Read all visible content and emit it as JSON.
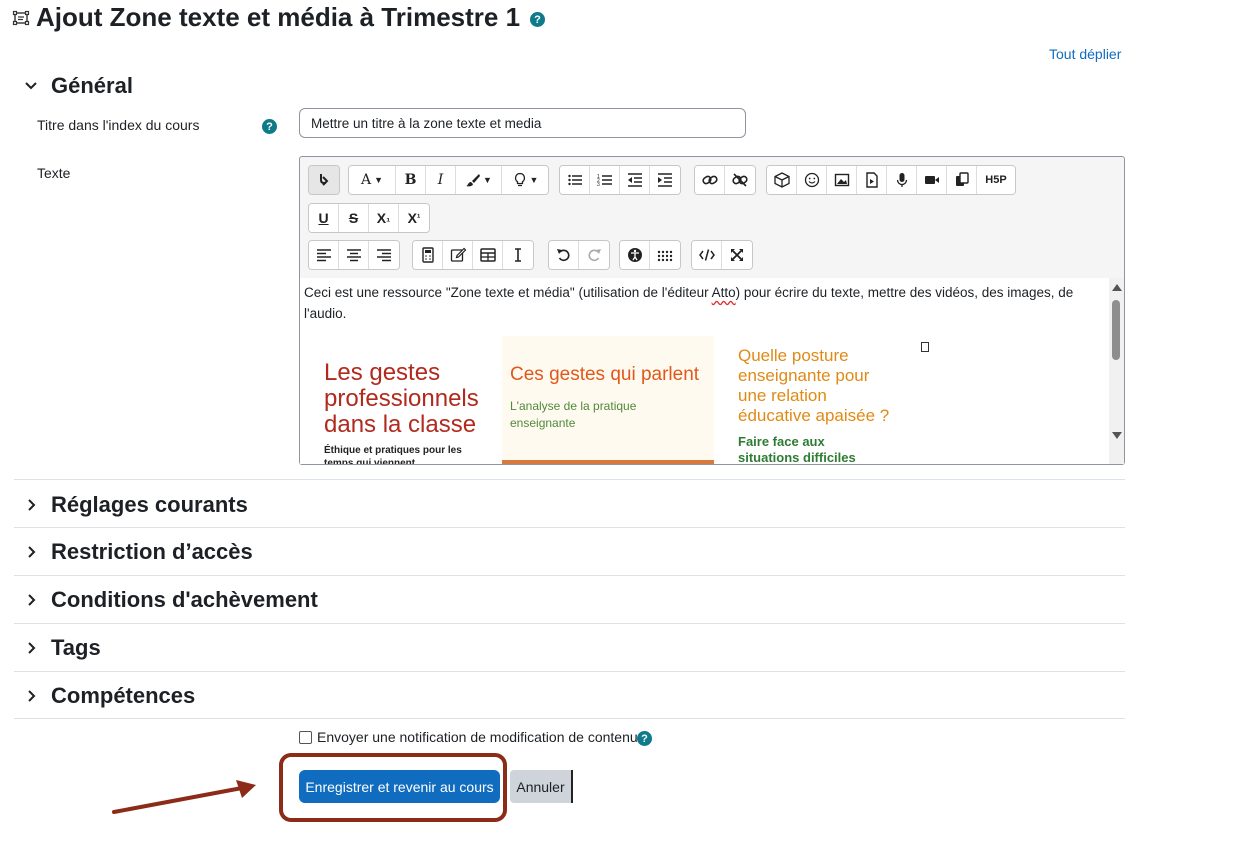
{
  "header": {
    "title": "Ajout Zone texte et média à Trimestre 1",
    "help_glyph": "?",
    "expand_all": "Tout déplier"
  },
  "general": {
    "section_title": "Général",
    "name_label": "Titre dans l'index du cours",
    "name_value": "Mettre un titre à la zone texte et media",
    "text_label": "Texte",
    "editor_content": {
      "text_before": "Ceci est une ressource \"Zone texte et média\" (utilisation de l'éditeur ",
      "text_misspelled": "Atto",
      "text_after": ") pour écrire du texte, mettre des vidéos, des images, de l'audio."
    },
    "images": [
      {
        "title": "Les gestes professionnels dans la classe",
        "subtitle": "Éthique et pratiques pour les temps qui viennent"
      },
      {
        "title": "Ces gestes qui parlent",
        "subtitle": "L'analyse de la pratique enseignante"
      },
      {
        "title": "Quelle posture enseignante pour une relation éducative apaisée ?",
        "subtitle": "Faire face aux situations difficiles"
      }
    ]
  },
  "toolbar": {
    "font_letter": "A",
    "bold": "B",
    "italic": "I",
    "underline": "U",
    "strike": "S",
    "sub_base": "X",
    "sub_idx": "₁",
    "sup_base": "X",
    "sup_idx": "¹",
    "h5p": "H5P"
  },
  "sections": [
    {
      "title": "Réglages courants"
    },
    {
      "title": "Restriction d’accès"
    },
    {
      "title": "Conditions d'achèvement"
    },
    {
      "title": "Tags"
    },
    {
      "title": "Compétences"
    }
  ],
  "footer": {
    "notify_label": "Envoyer une notification de modification de contenu",
    "save_button": "Enregistrer et revenir au cours",
    "cancel_button": "Annuler"
  },
  "colors": {
    "primary": "#0f6cbf",
    "help": "#0f7a8a",
    "annotation": "#8b2b18"
  },
  "icons": [
    "activity-icon",
    "chevron-down-icon",
    "chevron-right-icon",
    "help-icon",
    "arrow-icon"
  ]
}
